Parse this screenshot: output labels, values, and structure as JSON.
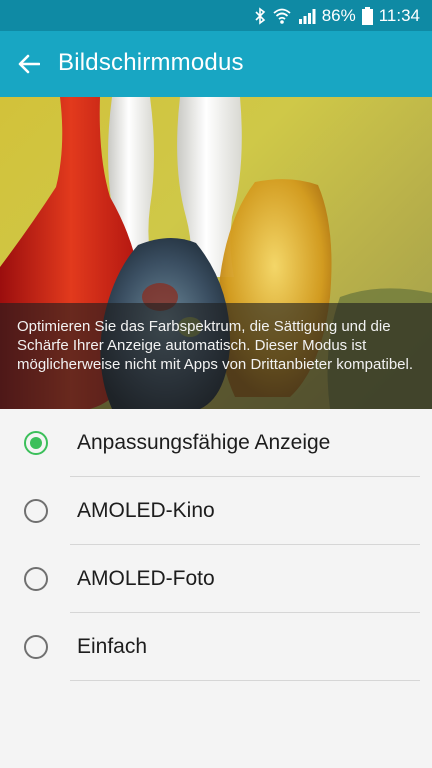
{
  "status_bar": {
    "battery": "86%",
    "time": "11:34",
    "icons": [
      "bluetooth-icon",
      "wifi-icon",
      "signal-icon",
      "battery-icon"
    ]
  },
  "app_bar": {
    "title": "Bildschirmmodus",
    "back_icon": "arrow-left-icon"
  },
  "hero": {
    "description": "Optimieren Sie das Farbspektrum, die Sättigung und die Schärfe Ihrer Anzeige automatisch. Dieser Modus ist möglicherweise nicht mit Apps von Drittanbieter kompatibel."
  },
  "options": [
    {
      "label": "Anpassungsfähige Anzeige",
      "selected": true
    },
    {
      "label": "AMOLED-Kino",
      "selected": false
    },
    {
      "label": "AMOLED-Foto",
      "selected": false
    },
    {
      "label": "Einfach",
      "selected": false
    }
  ],
  "colors": {
    "status_bar": "#0f8aa4",
    "app_bar": "#18a6c3",
    "accent": "#3bbf5a"
  }
}
